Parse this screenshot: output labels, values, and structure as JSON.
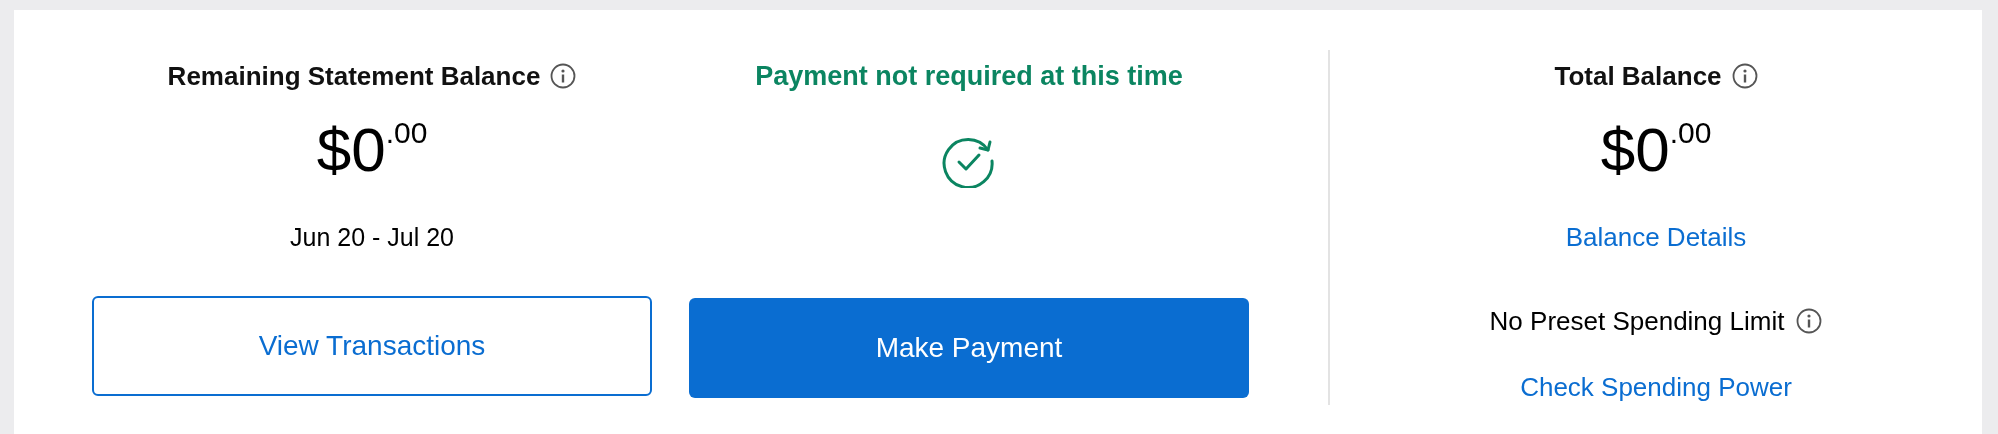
{
  "statement": {
    "title": "Remaining Statement Balance",
    "amount": {
      "whole": "$0",
      "cents": ".00"
    },
    "period": "Jun 20 - Jul 20",
    "button": "View Transactions"
  },
  "payment": {
    "status": "Payment not required at this time",
    "button": "Make Payment"
  },
  "total": {
    "title": "Total Balance",
    "amount": {
      "whole": "$0",
      "cents": ".00"
    },
    "link": "Balance Details",
    "limit": "No Preset Spending Limit",
    "limit_link": "Check Spending Power"
  }
}
